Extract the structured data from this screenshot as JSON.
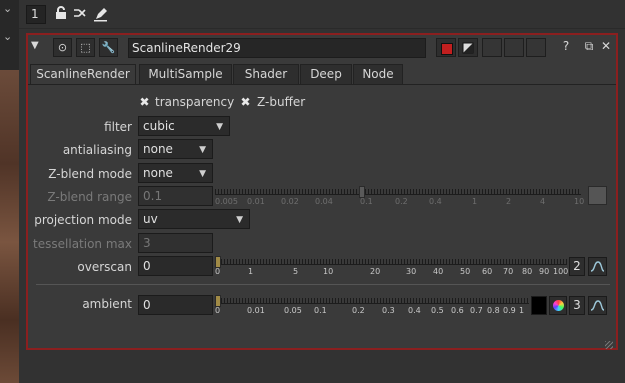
{
  "toolbar": {
    "stack_count": "1",
    "icons": [
      "lock-icon",
      "split-icon",
      "pencil-icon"
    ]
  },
  "node": {
    "name": "ScanlineRender29",
    "help": "?",
    "float": "⧉",
    "close": "✕"
  },
  "tabs": [
    "ScanlineRender",
    "MultiSample",
    "Shader",
    "Deep",
    "Node"
  ],
  "active_tab": "ScanlineRender",
  "checkboxes": {
    "transparency": {
      "label": "transparency",
      "checked": true
    },
    "zbuffer": {
      "label": "Z-buffer",
      "checked": true
    }
  },
  "knobs": {
    "filter": {
      "label": "filter",
      "value": "cubic"
    },
    "antialiasing": {
      "label": "antialiasing",
      "value": "none"
    },
    "zblend_mode": {
      "label": "Z-blend mode",
      "value": "none"
    },
    "zblend_range": {
      "label": "Z-blend range",
      "value": "0.1",
      "ticks": [
        "0.005",
        "0.01",
        "0.02",
        "0.04",
        "0.1",
        "0.2",
        "0.4",
        "1",
        "2",
        "4",
        "10"
      ]
    },
    "projection_mode": {
      "label": "projection mode",
      "value": "uv"
    },
    "tessellation_max": {
      "label": "tessellation max",
      "value": "3"
    },
    "overscan": {
      "label": "overscan",
      "value": "0",
      "ticks": [
        "0",
        "1",
        "5",
        "10",
        "20",
        "30",
        "40",
        "50",
        "60",
        "70",
        "80",
        "90",
        "100"
      ],
      "anim_count": "2"
    },
    "ambient": {
      "label": "ambient",
      "value": "0",
      "ticks": [
        "0",
        "0.01",
        "0.05",
        "0.1",
        "0.2",
        "0.3",
        "0.4",
        "0.5",
        "0.6",
        "0.7",
        "0.8",
        "0.9",
        "1"
      ],
      "channel_count": "3"
    }
  }
}
